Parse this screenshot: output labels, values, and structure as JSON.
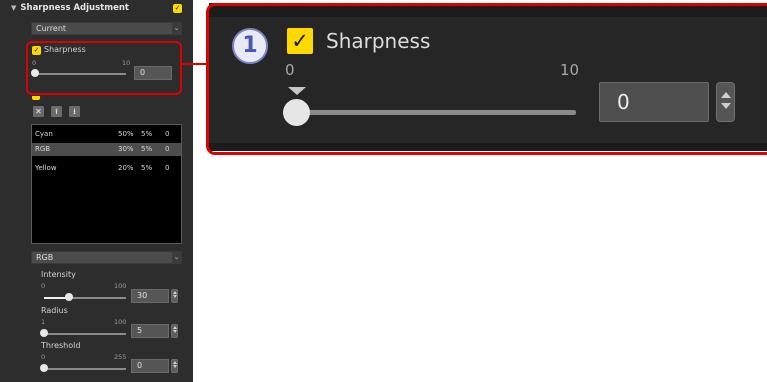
{
  "panel": {
    "title": "Sharpness Adjustment",
    "preset_value": "Current",
    "sharpness": {
      "label": "Sharpness",
      "min": "0",
      "max": "10",
      "value": "0",
      "level": 0
    },
    "color_table": {
      "rows": [
        {
          "name": "Cyan",
          "intensity": "50%",
          "radius": "5%",
          "threshold": "0"
        },
        {
          "name": "RGB",
          "intensity": "30%",
          "radius": "5%",
          "threshold": "0"
        },
        {
          "name": "Yellow",
          "intensity": "20%",
          "radius": "5%",
          "threshold": "0"
        }
      ],
      "selected_row": 1
    },
    "channel_value": "RGB",
    "intensity": {
      "label": "Intensity",
      "min": "0",
      "max": "100",
      "value": "30",
      "level": 0.3
    },
    "radius": {
      "label": "Radius",
      "min": "1",
      "max": "100",
      "value": "5",
      "level": 0.05
    },
    "threshold": {
      "label": "Threshold",
      "min": "0",
      "max": "255",
      "value": "0",
      "level": 0
    }
  },
  "zoom": {
    "badge": "1",
    "label": "Sharpness",
    "min": "0",
    "max": "10",
    "value": "0"
  },
  "icons": {
    "collapse": "triangle-down-icon",
    "checkbox": "checkmark-icon",
    "dropdown": "chevron-down-icon",
    "delete": "delete-point-icon",
    "move_up": "move-up-icon",
    "move_down": "move-down-icon"
  },
  "colors": {
    "accent": "#ffd800",
    "callout": "#e00000",
    "badge": "#4a56b4"
  }
}
